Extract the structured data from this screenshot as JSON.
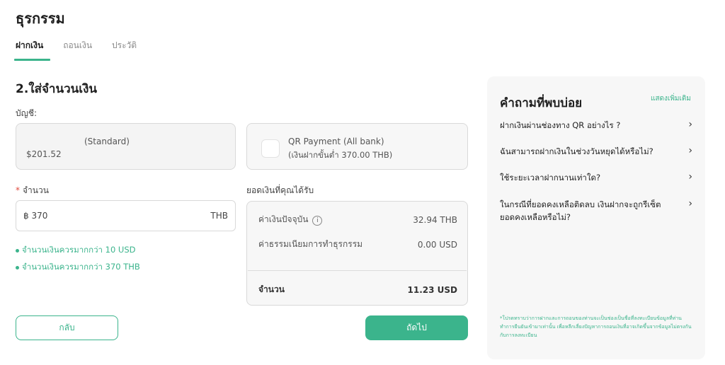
{
  "page": {
    "title": "ธุรกรรม"
  },
  "tabs": [
    {
      "label": "ฝากเงิน",
      "active": true
    },
    {
      "label": "ถอนเงิน",
      "active": false
    },
    {
      "label": "ประวัติ",
      "active": false
    }
  ],
  "form": {
    "step_title": "2.ใส่จำนวนเงิน",
    "account_label": "บัญชี:",
    "account": {
      "type": "(Standard)",
      "balance": "$201.52"
    },
    "payment": {
      "name": "QR Payment (All bank)",
      "min_deposit": "(เงินฝากขั้นต่ำ 370.00 THB)"
    },
    "amount_label": "จำนวน",
    "amount_required_mark": "*",
    "amount_value": "฿ 370",
    "amount_currency": "THB",
    "rules": [
      "จำนวนเงินควรมากกว่า 10 USD",
      "จำนวนเงินควรมากกว่า 370 THB"
    ],
    "receive_label": "ยอดเงินที่คุณได้รับ",
    "summary": {
      "rate_label": "ค่าเงินปัจจุบัน",
      "rate_value": "32.94 THB",
      "fee_label": "ค่าธรรมเนียมการทำธุรกรรม",
      "fee_value": "0.00 USD",
      "total_label": "จำนวน",
      "total_value": "11.23 USD"
    },
    "back_label": "กลับ",
    "next_label": "ถัดไป"
  },
  "faq": {
    "title": "คำถามที่พบบ่อย",
    "more_label": "แสดงเพิ่มเติม",
    "items": [
      "ฝากเงินผ่านช่องทาง QR อย่างไร ?",
      "ฉันสามารถฝากเงินในช่วงวันหยุดได้หรือไม่?",
      "ใช้ระยะเวลาฝากนานเท่าใด?",
      "ในกรณีที่ยอดคงเหลือติดลบ เงินฝากจะถูกรีเซ็ตยอดคงเหลือหรือไม่?"
    ],
    "note": "*โปรดทราบว่าการฝากและการถอนของท่านจะเป็นช่องเป็นชื่อที่ลงทะเบียนข้อมูลที่ท่านทำการยืนยันเข้ามาเท่านั้น เพื่อหลีกเลี่ยงปัญหาการถอนเงินที่อาจเกิดขึ้นจากข้อมูลไม่ตรงกันกับการลงทะเบียน"
  },
  "colors": {
    "accent": "#3bb48c",
    "required": "#e0483c",
    "panel_bg": "#f7f7f7"
  }
}
